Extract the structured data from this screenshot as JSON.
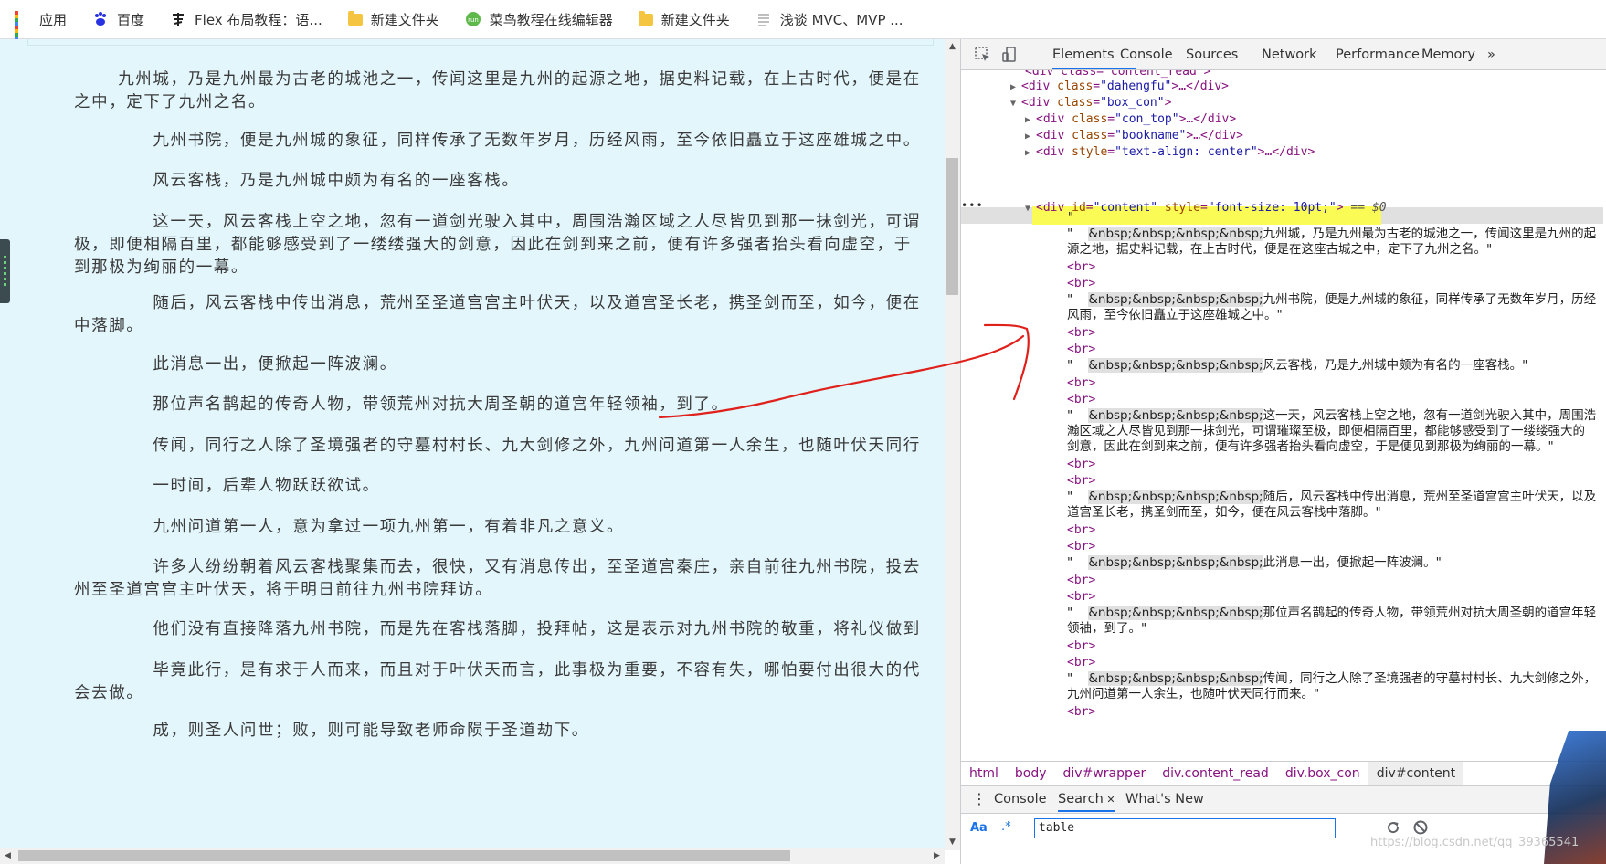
{
  "bookmarks": [
    {
      "label": "应用",
      "icon": "apps-grid-icon"
    },
    {
      "label": "百度",
      "icon": "baidu-paw-icon"
    },
    {
      "label": "Flex 布局教程：语...",
      "icon": "site-logo-icon"
    },
    {
      "label": "新建文件夹",
      "icon": "folder-icon"
    },
    {
      "label": "菜鸟教程在线编辑器",
      "icon": "runoob-icon"
    },
    {
      "label": "新建文件夹",
      "icon": "folder-icon"
    },
    {
      "label": "浅谈 MVC、MVP ...",
      "icon": "page-icon"
    }
  ],
  "page": {
    "paragraphs": [
      [
        "　　九州城，乃是九州最为古老的城池之一，传闻这里是九州的起源之地，据史料记载，在上古时代，便是在",
        "之中，定下了九州之名。"
      ],
      [
        "　　　　九州书院，便是九州城的象征，同样传承了无数年岁月，历经风雨，至今依旧矗立于这座雄城之中。"
      ],
      [
        "　　　　风云客栈，乃是九州城中颇为有名的一座客栈。"
      ],
      [
        "　　　　这一天，风云客栈上空之地，忽有一道剑光驶入其中，周围浩瀚区域之人尽皆见到那一抹剑光，可谓",
        "极，即便相隔百里，都能够感受到了一缕缕强大的剑意，因此在剑到来之前，便有许多强者抬头看向虚空，于",
        "到那极为绚丽的一幕。"
      ],
      [
        "　　　　随后，风云客栈中传出消息，荒州至圣道宫宫主叶伏天，以及道宫圣长老，携圣剑而至，如今，便在",
        "中落脚。"
      ],
      [
        "　　　　此消息一出，便掀起一阵波澜。"
      ],
      [
        "　　　　那位声名鹊起的传奇人物，带领荒州对抗大周圣朝的道宫年轻领袖，到了。"
      ],
      [
        "　　　　传闻，同行之人除了圣境强者的守墓村村长、九大剑修之外，九州问道第一人余生，也随叶伏天同行"
      ],
      [
        "　　　　一时间，后辈人物跃跃欲试。"
      ],
      [
        "　　　　九州问道第一人，意为拿过一项九州第一，有着非凡之意义。"
      ],
      [
        "　　　　许多人纷纷朝着风云客栈聚集而去，很快，又有消息传出，至圣道宫秦庄，亲自前往九州书院，投去",
        "州至圣道宫宫主叶伏天，将于明日前往九州书院拜访。"
      ],
      [
        "　　　　他们没有直接降落九州书院，而是先在客栈落脚，投拜帖，这是表示对九州书院的敬重，将礼仪做到"
      ],
      [
        "　　　　毕竟此行，是有求于人而来，而且对于叶伏天而言，此事极为重要，不容有失，哪怕要付出很大的代",
        "会去做。"
      ],
      [
        "　　　　成，则圣人问世；败，则可能导致老师命陨于圣道劫下。"
      ]
    ]
  },
  "devtools": {
    "tabs": [
      "Elements",
      "Console",
      "Sources",
      "Network",
      "Performance",
      "Memory",
      "»"
    ],
    "active_tab": "Elements",
    "dom": {
      "row0": "<div class=\"content_read\">",
      "dahengfu": {
        "tag": "div",
        "attr": "class",
        "val": "dahengfu",
        "tail": ">…</div>"
      },
      "box_con": {
        "tag": "div",
        "attr": "class",
        "val": "box_con",
        "tail": ">"
      },
      "con_top": {
        "tag": "div",
        "attr": "class",
        "val": "con_top",
        "tail": ">…</div>"
      },
      "bookname": {
        "tag": "div",
        "attr": "class",
        "val": "bookname",
        "tail": ">…</div>"
      },
      "styled": {
        "tag": "div",
        "attr": "style",
        "val": "text-align: center",
        "tail": ">…</div>"
      },
      "content": {
        "tag": "div",
        "attr1": "id",
        "val1": "content",
        "attr2": "style",
        "val2": "font-size: 10pt;",
        "tail": "> == $0"
      },
      "nodes": [
        {
          "type": "quote",
          "text": "\""
        },
        {
          "type": "text",
          "ent": "&nbsp;&nbsp;&nbsp;&nbsp;",
          "text": "九州城，乃是九州最为古老的城池之一，传闻这里是九州的起源之地，据史料记载，在上古时代，便是在这座古城之中，定下了九州之名。\""
        },
        {
          "type": "br",
          "text": "<br>"
        },
        {
          "type": "br",
          "text": "<br>"
        },
        {
          "type": "text",
          "ent": "&nbsp;&nbsp;&nbsp;&nbsp;",
          "text": "九州书院，便是九州城的象征，同样传承了无数年岁月，历经风雨，至今依旧矗立于这座雄城之中。\""
        },
        {
          "type": "br",
          "text": "<br>"
        },
        {
          "type": "br",
          "text": "<br>"
        },
        {
          "type": "text",
          "ent": "&nbsp;&nbsp;&nbsp;&nbsp;",
          "text": "风云客栈，乃是九州城中颇为有名的一座客栈。\""
        },
        {
          "type": "br",
          "text": "<br>"
        },
        {
          "type": "br",
          "text": "<br>"
        },
        {
          "type": "text",
          "ent": "&nbsp;&nbsp;&nbsp;&nbsp;",
          "text": "这一天，风云客栈上空之地，忽有一道剑光驶入其中，周围浩瀚区域之人尽皆见到那一抹剑光，可谓璀璨至极，即便相隔百里，都能够感受到了一缕缕强大的剑意，因此在剑到来之前，便有许多强者抬头看向虚空，于是便见到那极为绚丽的一幕。\""
        },
        {
          "type": "br",
          "text": "<br>"
        },
        {
          "type": "br",
          "text": "<br>"
        },
        {
          "type": "text",
          "ent": "&nbsp;&nbsp;&nbsp;&nbsp;",
          "text": "随后，风云客栈中传出消息，荒州至圣道宫宫主叶伏天，以及道宫圣长老，携圣剑而至，如今，便在风云客栈中落脚。\""
        },
        {
          "type": "br",
          "text": "<br>"
        },
        {
          "type": "br",
          "text": "<br>"
        },
        {
          "type": "text",
          "ent": "&nbsp;&nbsp;&nbsp;&nbsp;",
          "text": "此消息一出，便掀起一阵波澜。\""
        },
        {
          "type": "br",
          "text": "<br>"
        },
        {
          "type": "br",
          "text": "<br>"
        },
        {
          "type": "text",
          "ent": "&nbsp;&nbsp;&nbsp;&nbsp;",
          "text": "那位声名鹊起的传奇人物，带领荒州对抗大周圣朝的道宫年轻领袖，到了。\""
        },
        {
          "type": "br",
          "text": "<br>"
        },
        {
          "type": "br",
          "text": "<br>"
        },
        {
          "type": "text",
          "ent": "&nbsp;&nbsp;&nbsp;&nbsp;",
          "text": "传闻，同行之人除了圣境强者的守墓村村长、九大剑修之外，九州问道第一人余生，也随叶伏天同行而来。\""
        },
        {
          "type": "br",
          "text": "<br>"
        }
      ]
    },
    "breadcrumbs": [
      "html",
      "body",
      "div#wrapper",
      "div.content_read",
      "div.box_con",
      "div#content"
    ],
    "drawer_tabs": [
      "Console",
      "Search",
      "What's New"
    ],
    "active_drawer_tab": "Search",
    "search": {
      "case_label": "Aa",
      "regex_label": ".*",
      "value": "table"
    }
  },
  "watermark": "https://blog.csdn.net/qq_39365541",
  "colors": {
    "page_bg": "#e2f6fc",
    "highlight": "#ffff3c",
    "arrow": "#e0201a",
    "accent": "#1a73e8"
  }
}
